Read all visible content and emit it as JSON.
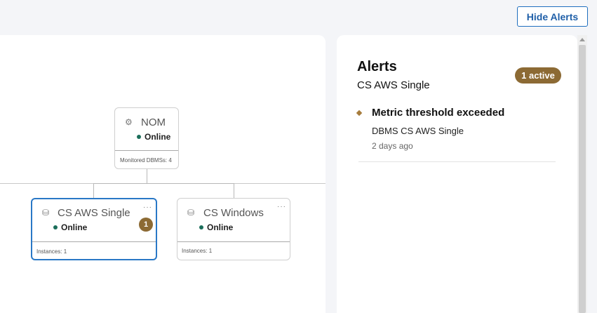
{
  "toolbar": {
    "hide_alerts_label": "Hide Alerts"
  },
  "topology": {
    "root": {
      "title": "NOM",
      "icon": "satellite-icon",
      "status": "Online",
      "footer": "Monitored DBMSs: 4"
    },
    "children": [
      {
        "title": "CS AWS Single",
        "icon": "database-cluster-icon",
        "status": "Online",
        "footer": "Instances: 1",
        "alert_count": "1",
        "menu": "···",
        "selected": true
      },
      {
        "title": "CS Windows",
        "icon": "database-cluster-icon",
        "status": "Online",
        "footer": "Instances: 1",
        "menu": "···",
        "selected": false
      }
    ],
    "colors": {
      "online": "#1b6e5a",
      "selected_border": "#2a78c6",
      "alert_badge": "#8c6a34"
    }
  },
  "alerts": {
    "title": "Alerts",
    "subtitle": "CS AWS Single",
    "active_label": "1 active",
    "items": [
      {
        "name": "Metric threshold exceeded",
        "description": "DBMS CS AWS Single",
        "time": "2 days ago"
      }
    ]
  }
}
